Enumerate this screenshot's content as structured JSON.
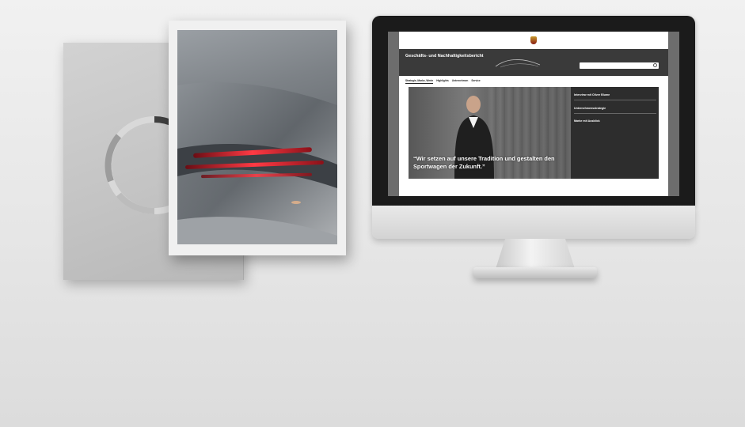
{
  "back_brochure": {
    "ring_color": "#9a9a9a",
    "ring_accent": "#4a4a4a"
  },
  "front_brochure": {
    "tail_light_color": "#d81f2a"
  },
  "monitor": {
    "website": {
      "report_title": "Geschäfts- und Nachhaltigkeitsbericht",
      "header_icon": "car-silhouette-icon",
      "search_icon": "search-icon",
      "nav": [
        {
          "label": "Strategie, Marke, Werte",
          "active": true
        },
        {
          "label": "Highlights"
        },
        {
          "label": "Unternehmen"
        },
        {
          "label": "Service"
        }
      ],
      "hero": {
        "quote": "“Wir setzen auf unsere Tradition und gestalten den Sportwagen der Zukunft.”",
        "side_headings": [
          "Interview mit Oliver Blume",
          "Unternehmensstrategie",
          "Marke mit Ausblick"
        ]
      }
    }
  }
}
